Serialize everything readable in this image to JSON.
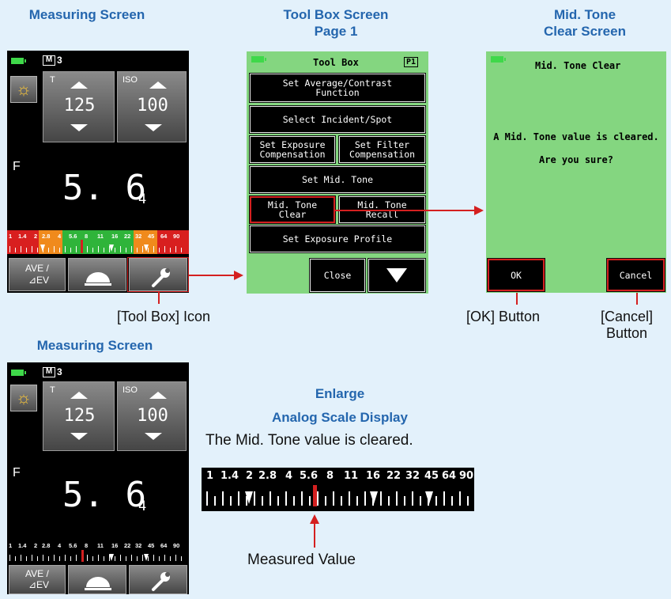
{
  "titles": {
    "measuring_top": "Measuring Screen",
    "toolbox_line1": "Tool Box Screen",
    "toolbox_line2": "Page 1",
    "midclear_line1": "Mid. Tone",
    "midclear_line2": "Clear Screen",
    "measuring_bottom": "Measuring Screen",
    "enlarge_line1": "Enlarge",
    "enlarge_line2": "Analog Scale Display"
  },
  "captions": {
    "toolbox_icon": "[Tool Box] Icon",
    "ok_button": "[OK] Button",
    "cancel_line1": "[Cancel]",
    "cancel_line2": "Button",
    "cleared_msg": "The Mid. Tone value is cleared.",
    "measured_value": "Measured Value"
  },
  "meter": {
    "mode_badge": "M",
    "mode_num": "3",
    "t_label": "T",
    "t_value": "125",
    "iso_label": "ISO",
    "iso_value": "100",
    "f_label": "F",
    "f_main": "5. 6",
    "f_sub": "4",
    "ave_line1": "AVE /",
    "ave_line2": "⊿EV",
    "scale_numbers": [
      "1",
      "1.4",
      "2",
      "2.8",
      "4",
      "5.6",
      "8",
      "11",
      "16",
      "22",
      "32",
      "45",
      "64",
      "90"
    ]
  },
  "toolbox": {
    "title": "Tool Box",
    "page": "P1",
    "btn_avg_1": "Set Average/Contrast",
    "btn_avg_2": "Function",
    "btn_incident": "Select Incident/Spot",
    "btn_exp_comp_1": "Set Exposure",
    "btn_exp_comp_2": "Compensation",
    "btn_filter_1": "Set Filter",
    "btn_filter_2": "Compensation",
    "btn_midtone": "Set Mid. Tone",
    "btn_mid_clear_1": "Mid. Tone",
    "btn_mid_clear_2": "Clear",
    "btn_mid_recall_1": "Mid. Tone",
    "btn_mid_recall_2": "Recall",
    "btn_profile": "Set Exposure Profile",
    "btn_close": "Close"
  },
  "midclear": {
    "title": "Mid. Tone Clear",
    "msg1": "A Mid. Tone value is cleared.",
    "msg2": "Are you sure?",
    "ok": "OK",
    "cancel": "Cancel"
  },
  "colors": {
    "title_blue": "#2466ae",
    "background": "#e3f1fb",
    "screen_green": "#84d680",
    "highlight_red": "#d42020"
  }
}
